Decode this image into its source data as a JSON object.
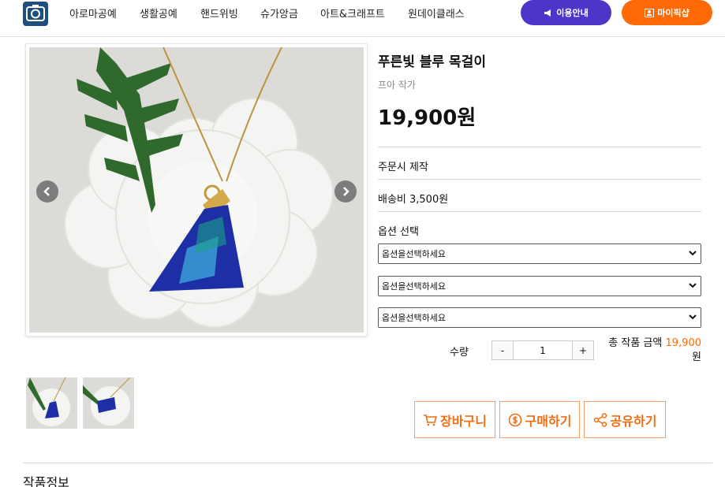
{
  "header": {
    "nav": [
      "아로마공예",
      "생활공예",
      "핸드위빙",
      "슈가앙금",
      "아트&크래프트",
      "원데이클래스"
    ],
    "info_button": "이용안내",
    "mypage_button": "마이픽샵",
    "colors": {
      "info": "#4e34c9",
      "mypage": "#ff6a06"
    }
  },
  "product": {
    "title": "푸른빛 블루 목걸이",
    "artist": "프아 작가",
    "price": "19,900원",
    "production": "주문시 제작",
    "shipping": "배송비 3,500원",
    "option_label": "옵션 선택",
    "options": [
      "옵션을선택하세요",
      "옵션을선택하세요",
      "옵션을선택하세요"
    ],
    "quantity_label": "수량",
    "quantity": "1",
    "minus": "-",
    "plus": "+",
    "total_label": "총 작품 금액",
    "total_amount": "19,900",
    "total_unit": "원"
  },
  "actions": {
    "cart": "장바구니",
    "buy": "구매하기",
    "share": "공유하기",
    "accent": "#f06d11"
  },
  "section": {
    "title": "작품정보"
  }
}
